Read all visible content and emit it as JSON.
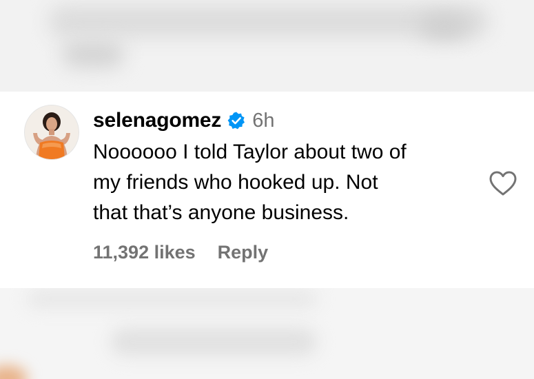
{
  "comment": {
    "username": "selenagomez",
    "verified_icon": "verified-badge-icon",
    "time": "6h",
    "text_lines": [
      "Noooooo I told Taylor about two of",
      "my friends who hooked up. Not",
      "that that’s anyone business."
    ],
    "likes_label": "11,392 likes",
    "reply_label": "Reply",
    "like_icon": "heart-outline-icon",
    "avatar_icon": "profile-avatar"
  },
  "colors": {
    "verified_blue": "#0095f6",
    "secondary_text": "#737373",
    "primary_text": "#000000",
    "background": "#ffffff"
  }
}
